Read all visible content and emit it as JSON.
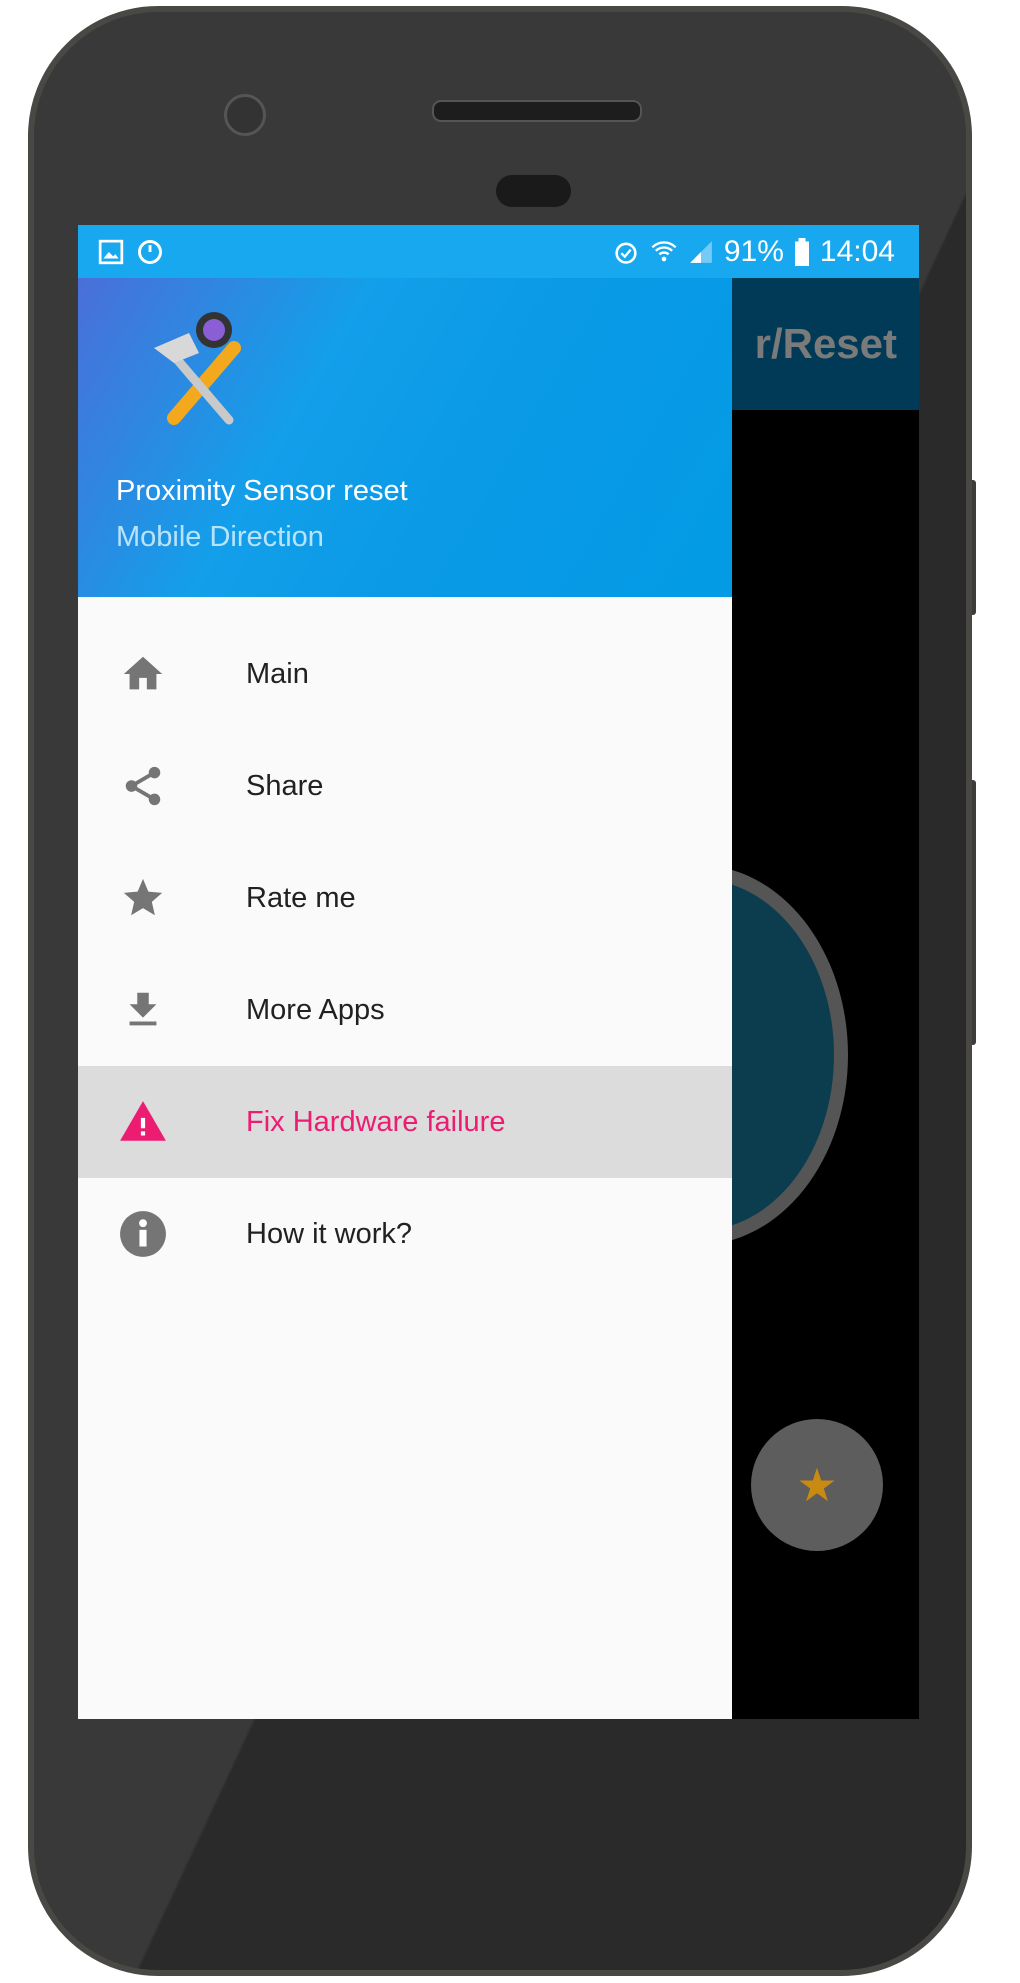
{
  "status_bar": {
    "battery": "91%",
    "time": "14:04",
    "icons": [
      "image-icon",
      "sync-icon",
      "alarm-icon",
      "wifi-icon",
      "signal-icon",
      "battery-icon"
    ]
  },
  "app_bar": {
    "title_partial": "r/Reset"
  },
  "drawer": {
    "header": {
      "title": "Proximity Sensor reset",
      "subtitle": "Mobile Direction"
    },
    "items": [
      {
        "label": "Main",
        "icon": "home-icon"
      },
      {
        "label": "Share",
        "icon": "share-icon"
      },
      {
        "label": "Rate me",
        "icon": "star-icon"
      },
      {
        "label": "More Apps",
        "icon": "download-icon"
      },
      {
        "label": "Fix Hardware failure",
        "icon": "warning-icon",
        "selected": true
      },
      {
        "label": "How it work?",
        "icon": "info-icon"
      }
    ]
  },
  "colors": {
    "status_bar": "#18a8ef",
    "header": "#039be5",
    "accent": "#ec1c73",
    "icon": "#757575"
  }
}
